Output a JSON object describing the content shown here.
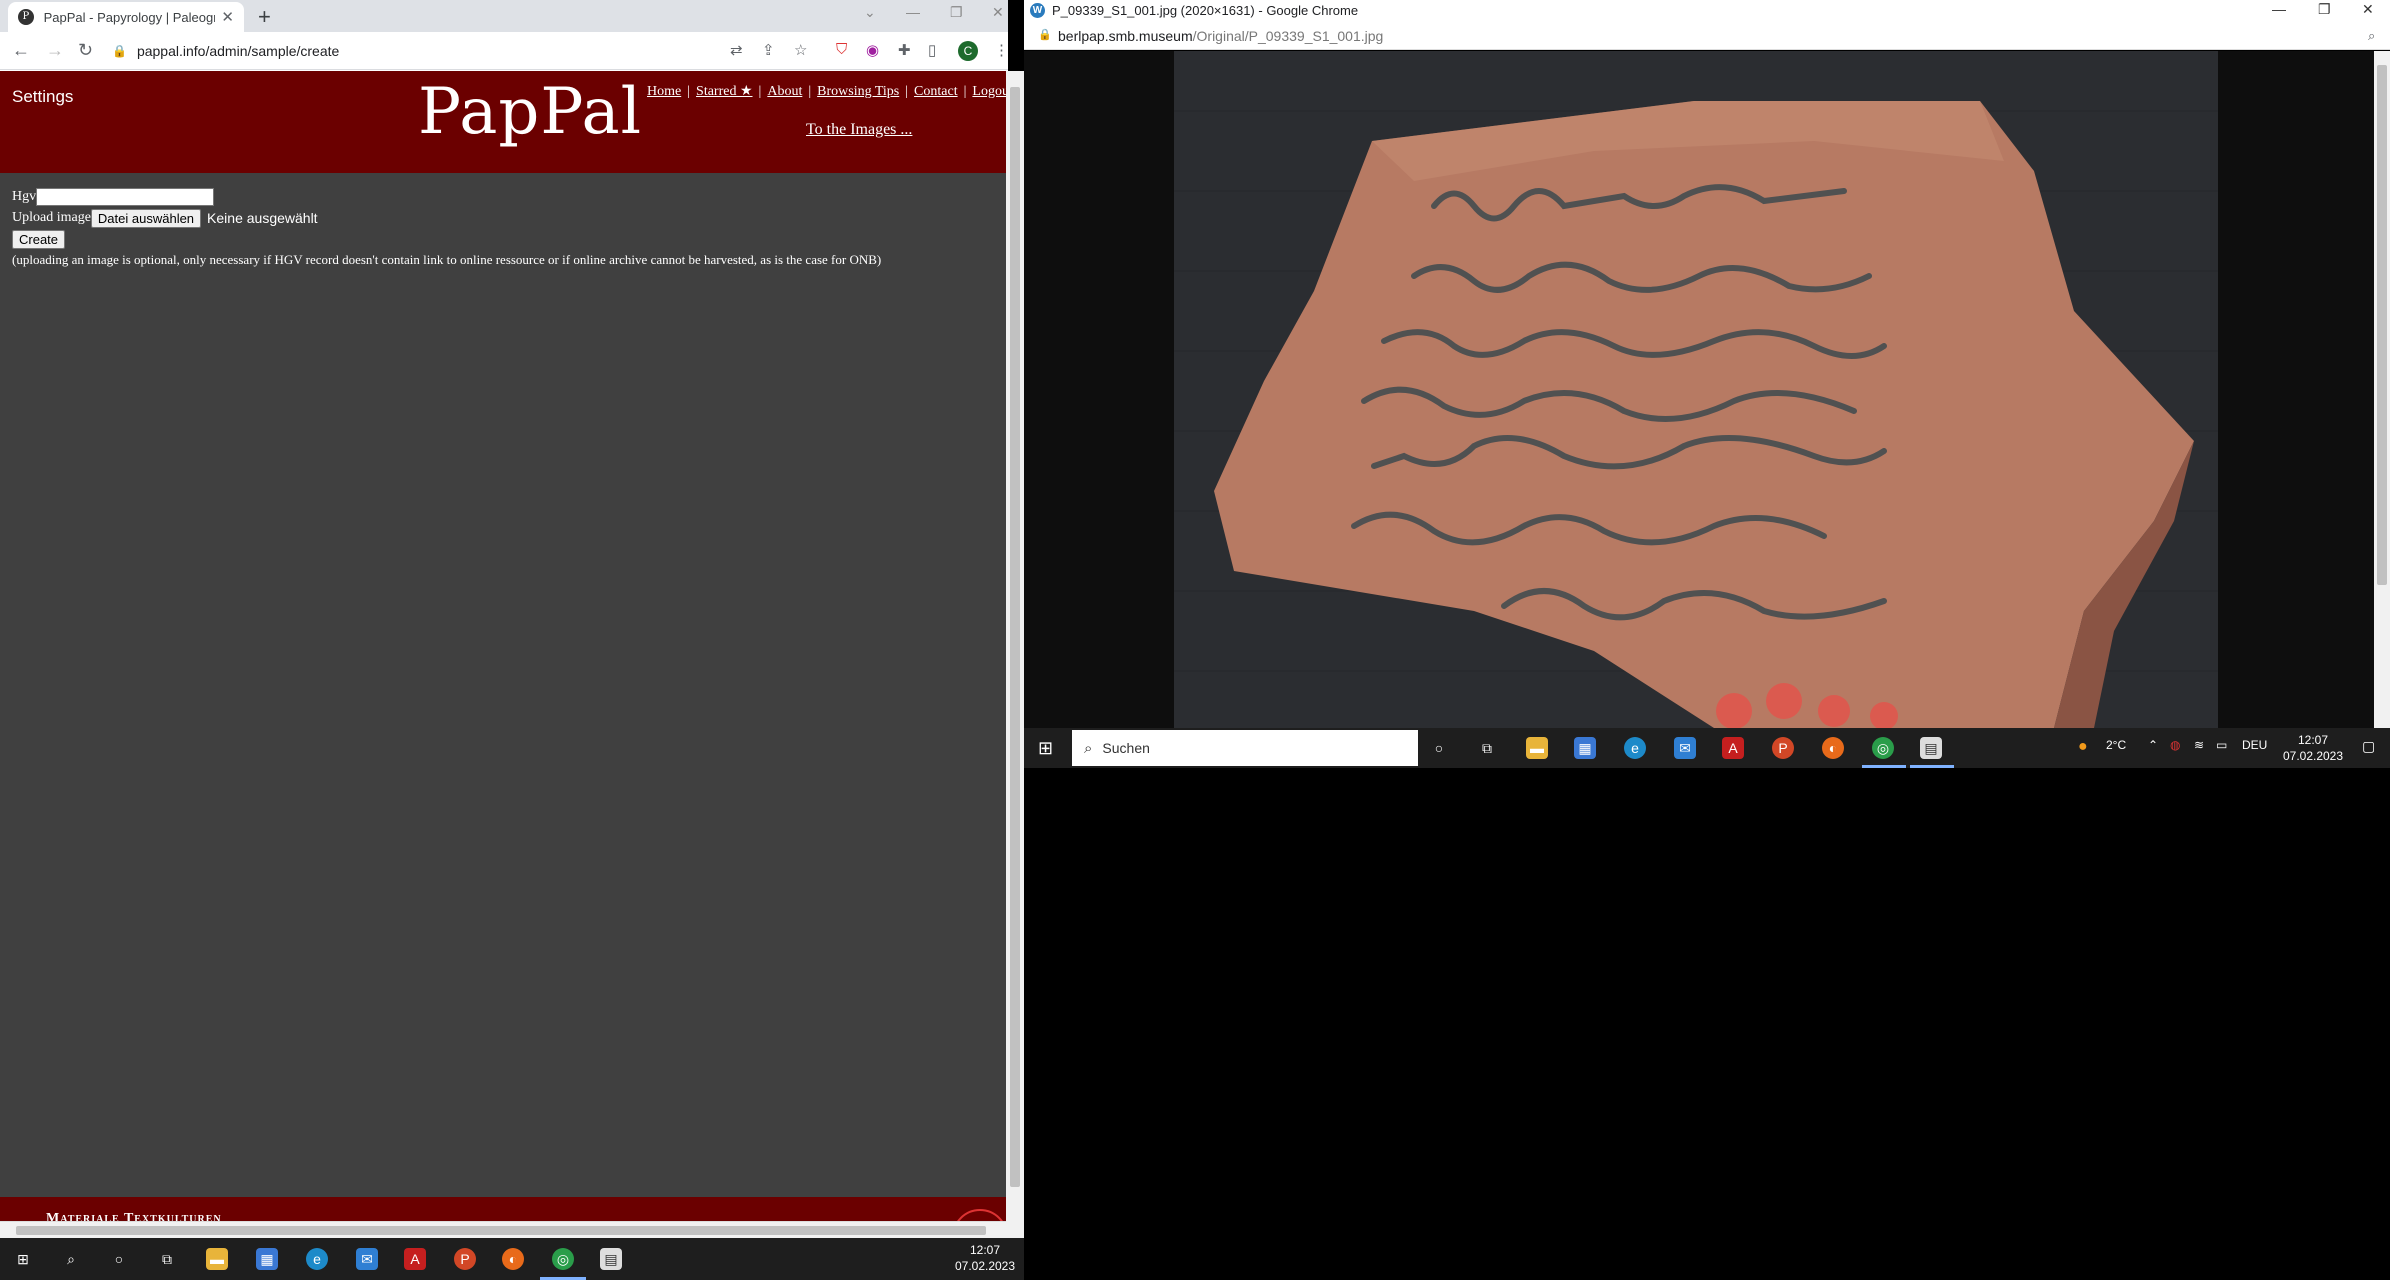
{
  "left_window": {
    "tab_title": "PapPal - Papyrology | Paleograph",
    "url": "pappal.info/admin/sample/create",
    "profile_initial": "C",
    "site": {
      "settings_label": "Settings",
      "logo": "PapPal",
      "nav": [
        "Home",
        "Starred ★",
        "About",
        "Browsing Tips",
        "Contact",
        "Logou"
      ],
      "to_images": "To the Images ..."
    },
    "form": {
      "hgv_label": "Hgv",
      "hgv_value": "",
      "upload_label": "Upload image",
      "file_button": "Datei auswählen",
      "file_state": "Keine ausgewählt",
      "create_button": "Create",
      "note": "(uploading an image is optional, only necessary if HGV record doesn't contain link to online ressource or if online archive cannot be harvested, as is the case for ONB)"
    },
    "footer_text": "Materiale Textkulturen"
  },
  "right_window": {
    "title": "P_09339_S1_001.jpg (2020×1631) - Google Chrome",
    "url_domain": "berlpap.smb.museum",
    "url_path": "/Original/P_09339_S1_001.jpg"
  },
  "right_taskbar": {
    "search_placeholder": "Suchen",
    "weather": "2°C",
    "language": "DEU",
    "time": "12:07",
    "date": "07.02.2023"
  },
  "bottom_taskbar": {
    "time": "12:07",
    "date": "07.02.2023"
  },
  "colors": {
    "header_red": "#6b0000",
    "page_gray": "#404040",
    "taskbar": "#1e1e1e"
  }
}
